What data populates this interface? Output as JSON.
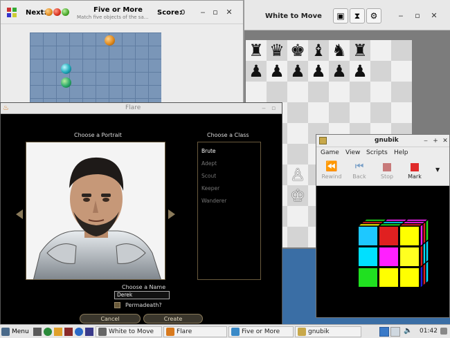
{
  "five_or_more": {
    "title": "Five or More",
    "subtitle": "Match five objects of the sa...",
    "next_label": "Next:",
    "score_label": "Score:",
    "score_value": "0"
  },
  "chess": {
    "title": "White to Move"
  },
  "flare": {
    "title": "Flare",
    "portrait_heading": "Choose a Portrait",
    "class_heading": "Choose a Class",
    "classes": [
      "Brute",
      "Adept",
      "Scout",
      "Keeper",
      "Wanderer"
    ],
    "name_heading": "Choose a Name",
    "name_value": "Derek",
    "permadeath_label": "Permadeath?",
    "cancel_label": "Cancel",
    "create_label": "Create"
  },
  "gnubik": {
    "title": "gnubik",
    "menu": [
      "Game",
      "View",
      "Scripts",
      "Help"
    ],
    "tools": [
      "Rewind",
      "Back",
      "Stop",
      "Mark"
    ]
  },
  "taskbar": {
    "menu_label": "Menu",
    "tasks": [
      "White to Move",
      "Flare",
      "Five or More",
      "gnubik"
    ],
    "clock": "01:42"
  }
}
